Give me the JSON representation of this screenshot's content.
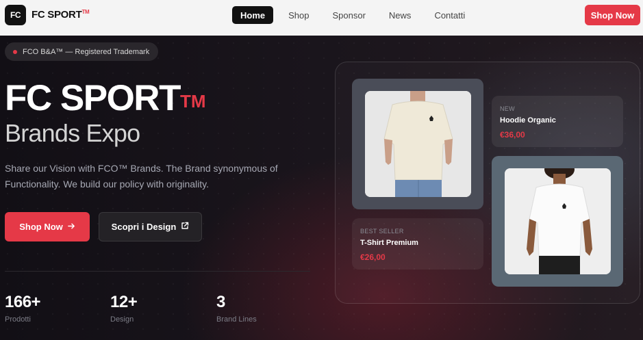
{
  "nav": {
    "logo_mark": "FC",
    "logo_text": "FC SPORT",
    "logo_tm": "TM",
    "links": [
      {
        "label": "Home",
        "active": true
      },
      {
        "label": "Shop",
        "active": false
      },
      {
        "label": "Sponsor",
        "active": false
      },
      {
        "label": "News",
        "active": false
      },
      {
        "label": "Contatti",
        "active": false
      }
    ],
    "cta": "Shop Now"
  },
  "hero": {
    "badge": "FCO B&A™ — Registered Trademark",
    "title": "FC SPORT",
    "title_tm": "TM",
    "subtitle": "Brands Expo",
    "description": "Share our Vision with FCO™ Brands. The Brand synonymous of Functionality. We build our policy with originality.",
    "primary_button": "Shop Now",
    "primary_icon": "arrow-right-icon",
    "secondary_button": "Scopri i Design",
    "secondary_icon": "external-link-icon"
  },
  "stats": [
    {
      "value": "166+",
      "label": "Prodotti"
    },
    {
      "value": "12+",
      "label": "Design"
    },
    {
      "value": "3",
      "label": "Brand Lines"
    }
  ],
  "showcase": {
    "card_1": {
      "tag": "NEW",
      "name": "Hoodie Organic",
      "price": "€36,00"
    },
    "card_2": {
      "tag": "BEST SELLER",
      "name": "T-Shirt Premium",
      "price": "€26,00"
    }
  },
  "colors": {
    "accent": "#e53947",
    "nav_bg": "#f4f4f4",
    "hero_bg": "#141118"
  }
}
